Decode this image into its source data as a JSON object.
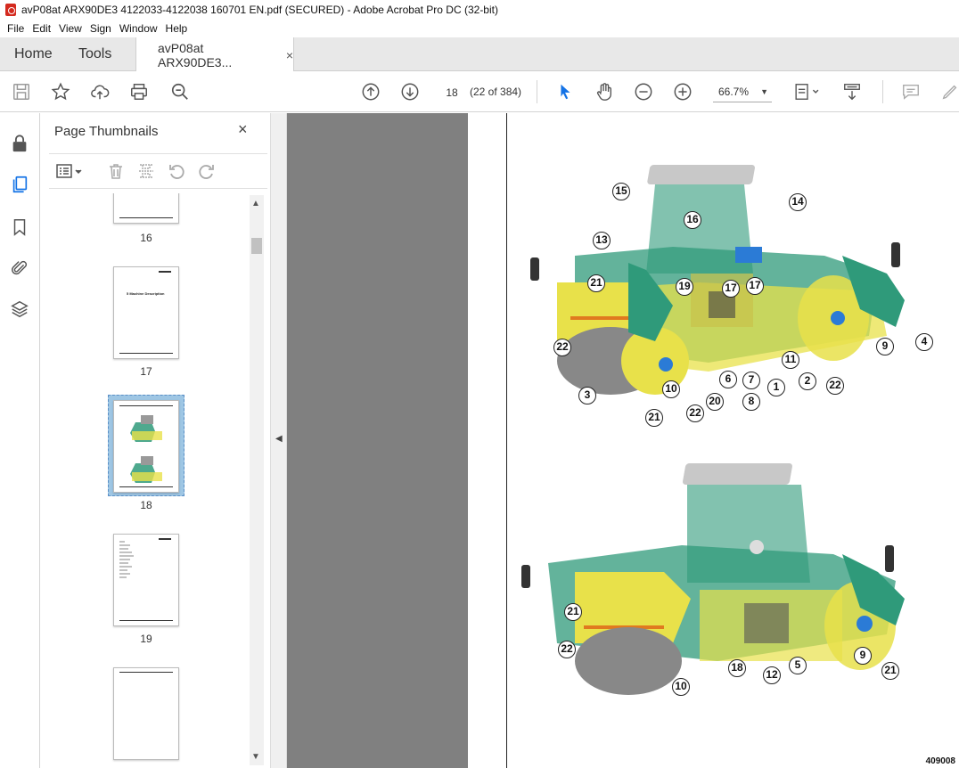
{
  "window": {
    "title": "avP08at ARX90DE3 4122033-4122038 160701 EN.pdf (SECURED) - Adobe Acrobat Pro DC (32-bit)"
  },
  "menu": [
    "File",
    "Edit",
    "View",
    "Sign",
    "Window",
    "Help"
  ],
  "tabs": {
    "home": "Home",
    "tools": "Tools",
    "document": "avP08at ARX90DE3...",
    "close": "×"
  },
  "toolbar": {
    "page_number": "18",
    "page_count": "(22 of 384)",
    "zoom": "66.7%"
  },
  "thumbnails_panel": {
    "title": "Page Thumbnails",
    "close": "×",
    "pages": [
      {
        "label": "16"
      },
      {
        "label": "17",
        "heading": "5 Machine Description"
      },
      {
        "label": "18"
      },
      {
        "label": "19"
      },
      {
        "label": ""
      }
    ]
  },
  "document": {
    "figure_code": "409008",
    "callouts_top": [
      "15",
      "16",
      "14",
      "13",
      "21",
      "19",
      "17",
      "17",
      "22",
      "4",
      "9",
      "11",
      "2",
      "22",
      "3",
      "6",
      "7",
      "1",
      "10",
      "21",
      "22",
      "20",
      "8"
    ],
    "callouts_bottom": [
      "21",
      "22",
      "18",
      "12",
      "5",
      "9",
      "21",
      "10"
    ]
  },
  "colors": {
    "accent": "#1473e6",
    "machine_green": "#2f9a7a",
    "machine_yellow": "#e8e14a",
    "doc_background": "#808080"
  }
}
